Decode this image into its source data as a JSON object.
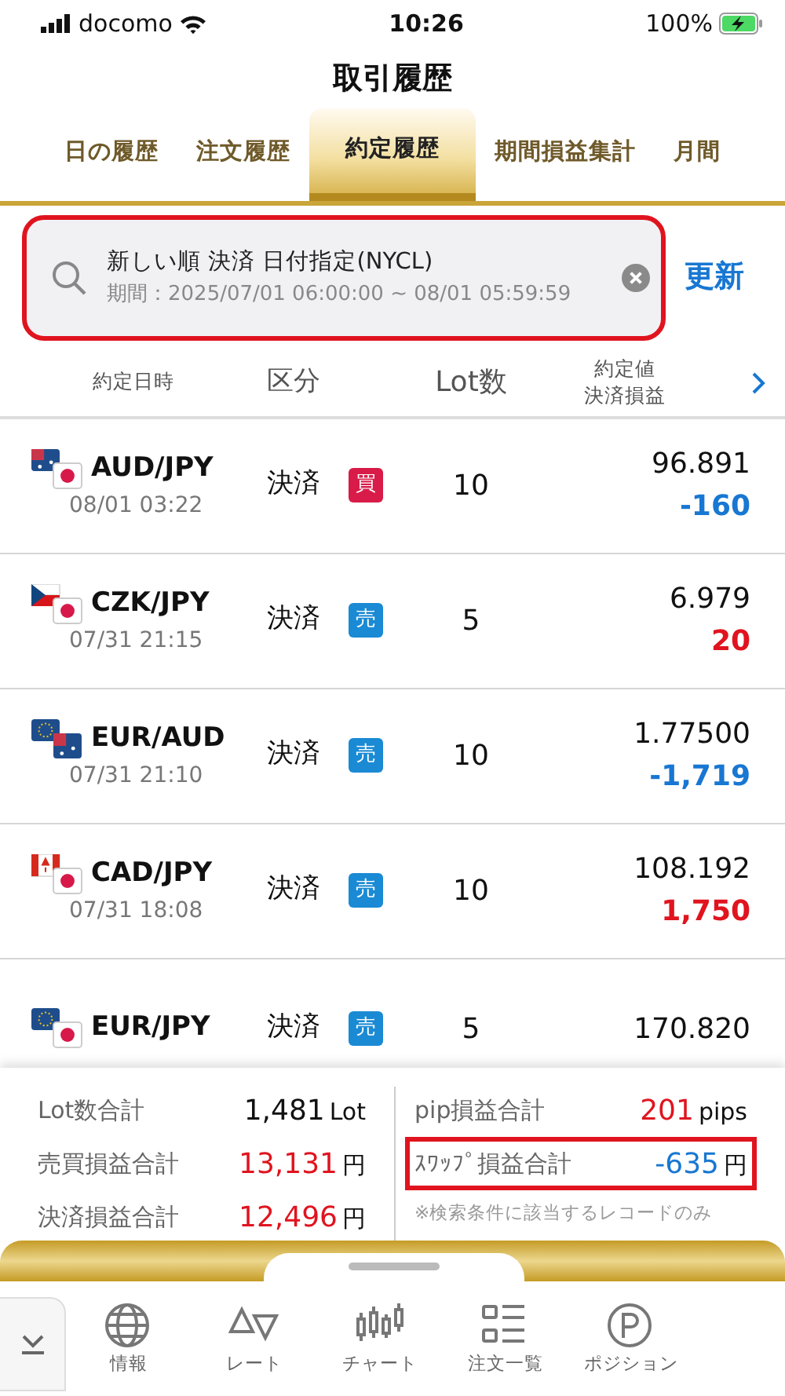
{
  "status_bar": {
    "carrier": "docomo",
    "time": "10:26",
    "battery": "100%"
  },
  "title": "取引履歴",
  "tabs": [
    {
      "label": "日の履歴",
      "selected": false
    },
    {
      "label": "注文履歴",
      "selected": false
    },
    {
      "label": "約定履歴",
      "selected": true
    },
    {
      "label": "期間損益集計",
      "selected": false
    },
    {
      "label": "月間",
      "selected": false
    }
  ],
  "search": {
    "query": "新しい順 決済 日付指定(NYCL)",
    "period": "期間：2025/07/01 06:00:00 ~ 08/01 05:59:59",
    "highlighted": true,
    "refresh": "更新"
  },
  "table": {
    "columns": [
      "約定日時",
      "区分",
      "Lot数",
      "約定値",
      "決済損益"
    ],
    "rows": [
      {
        "pair": "AUD/JPY",
        "time": "08/01 03:22",
        "type": "決済",
        "kind": "buy",
        "side_label": "買",
        "lots": "10",
        "price": "96.891",
        "pl": "-160",
        "color": "#1877d2"
      },
      {
        "pair": "CZK/JPY",
        "time": "07/31 21:15",
        "type": "決済",
        "kind": "sell",
        "side_label": "売",
        "lots": "5",
        "price": "6.979",
        "pl": "20",
        "color": "#e0141f"
      },
      {
        "pair": "EUR/AUD",
        "time": "07/31 21:10",
        "type": "決済",
        "kind": "sell",
        "side_label": "売",
        "lots": "10",
        "price": "1.77500",
        "pl": "-1,719",
        "color": "#1877d2"
      },
      {
        "pair": "CAD/JPY",
        "time": "07/31 18:08",
        "type": "決済",
        "kind": "sell",
        "side_label": "売",
        "lots": "10",
        "price": "108.192",
        "pl": "1,750",
        "color": "#e0141f"
      },
      {
        "pair": "EUR/JPY",
        "type": "決済",
        "kind": "sell",
        "side_label": "売",
        "lots": "5",
        "price": "170.820"
      }
    ]
  },
  "summary": {
    "left": [
      {
        "label": "Lot数合計",
        "value": "1,481",
        "unit": "Lot",
        "color": "#111111"
      },
      {
        "label": "売買損益合計",
        "value": "13,131",
        "unit": "円",
        "color": "#e0141f"
      },
      {
        "label": "決済損益合計",
        "value": "12,496",
        "unit": "円",
        "color": "#e0141f"
      }
    ],
    "right": [
      {
        "label": "pip損益合計",
        "value": "201",
        "unit": "pips",
        "color": "#e0141f",
        "highlighted": false
      },
      {
        "label": "ｽﾜｯﾌﾟ損益合計",
        "value": "-635",
        "unit": "円",
        "color": "#1877d2",
        "highlighted": true
      }
    ],
    "note": "※検索条件に該当するレコードのみ"
  },
  "bottom_nav": [
    {
      "label": "情報"
    },
    {
      "label": "レート"
    },
    {
      "label": "チャート"
    },
    {
      "label": "注文一覧"
    },
    {
      "label": "ポジション"
    }
  ]
}
